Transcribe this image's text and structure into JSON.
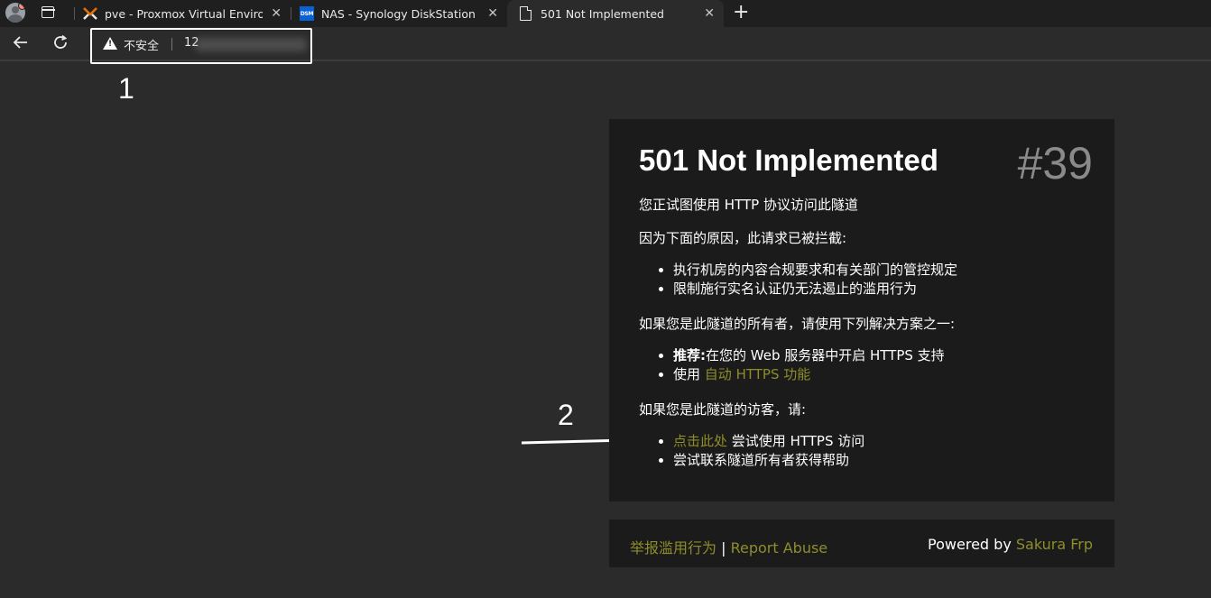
{
  "browser": {
    "tabs": [
      {
        "title": "pve - Proxmox Virtual Environment",
        "favicon": "proxmox-icon"
      },
      {
        "title": "NAS - Synology DiskStation",
        "favicon": "dsm-icon",
        "favicon_text": "DSM"
      },
      {
        "title": "501 Not Implemented",
        "favicon": "document-icon",
        "active": true
      }
    ],
    "close_glyph": "✕",
    "new_tab_glyph": "+",
    "security_label": "不安全",
    "url_visible": "12"
  },
  "annotations": {
    "box_label": "1",
    "arrow_label": "2"
  },
  "error": {
    "title": "501 Not Implemented",
    "code": "#39",
    "intro": "您正试图使用 HTTP 协议访问此隧道",
    "reason_heading": "因为下面的原因，此请求已被拦截:",
    "reasons": [
      "执行机房的内容合规要求和有关部门的管控规定",
      "限制施行实名认证仍无法遏止的滥用行为"
    ],
    "owner_heading": "如果您是此隧道的所有者，请使用下列解决方案之一:",
    "owner_solutions": {
      "recommend_bold": "推荐:",
      "recommend_text": "在您的 Web 服务器中开启 HTTPS 支持",
      "use_prefix": "使用",
      "use_link": "自动 HTTPS 功能"
    },
    "visitor_heading": "如果您是此隧道的访客，请:",
    "visitor_actions": {
      "click_link": "点击此处",
      "click_text": "尝试使用 HTTPS 访问",
      "contact": "尝试联系隧道所有者获得帮助"
    }
  },
  "footer": {
    "report_cn": "举报滥用行为",
    "divider": "|",
    "report_en": "Report Abuse",
    "powered_prefix": "Powered by",
    "powered_link": "Sakura Frp"
  },
  "colors": {
    "link": "#8e8d2a",
    "card_bg": "#1b1b1b",
    "page_bg": "#2b2b2b"
  }
}
